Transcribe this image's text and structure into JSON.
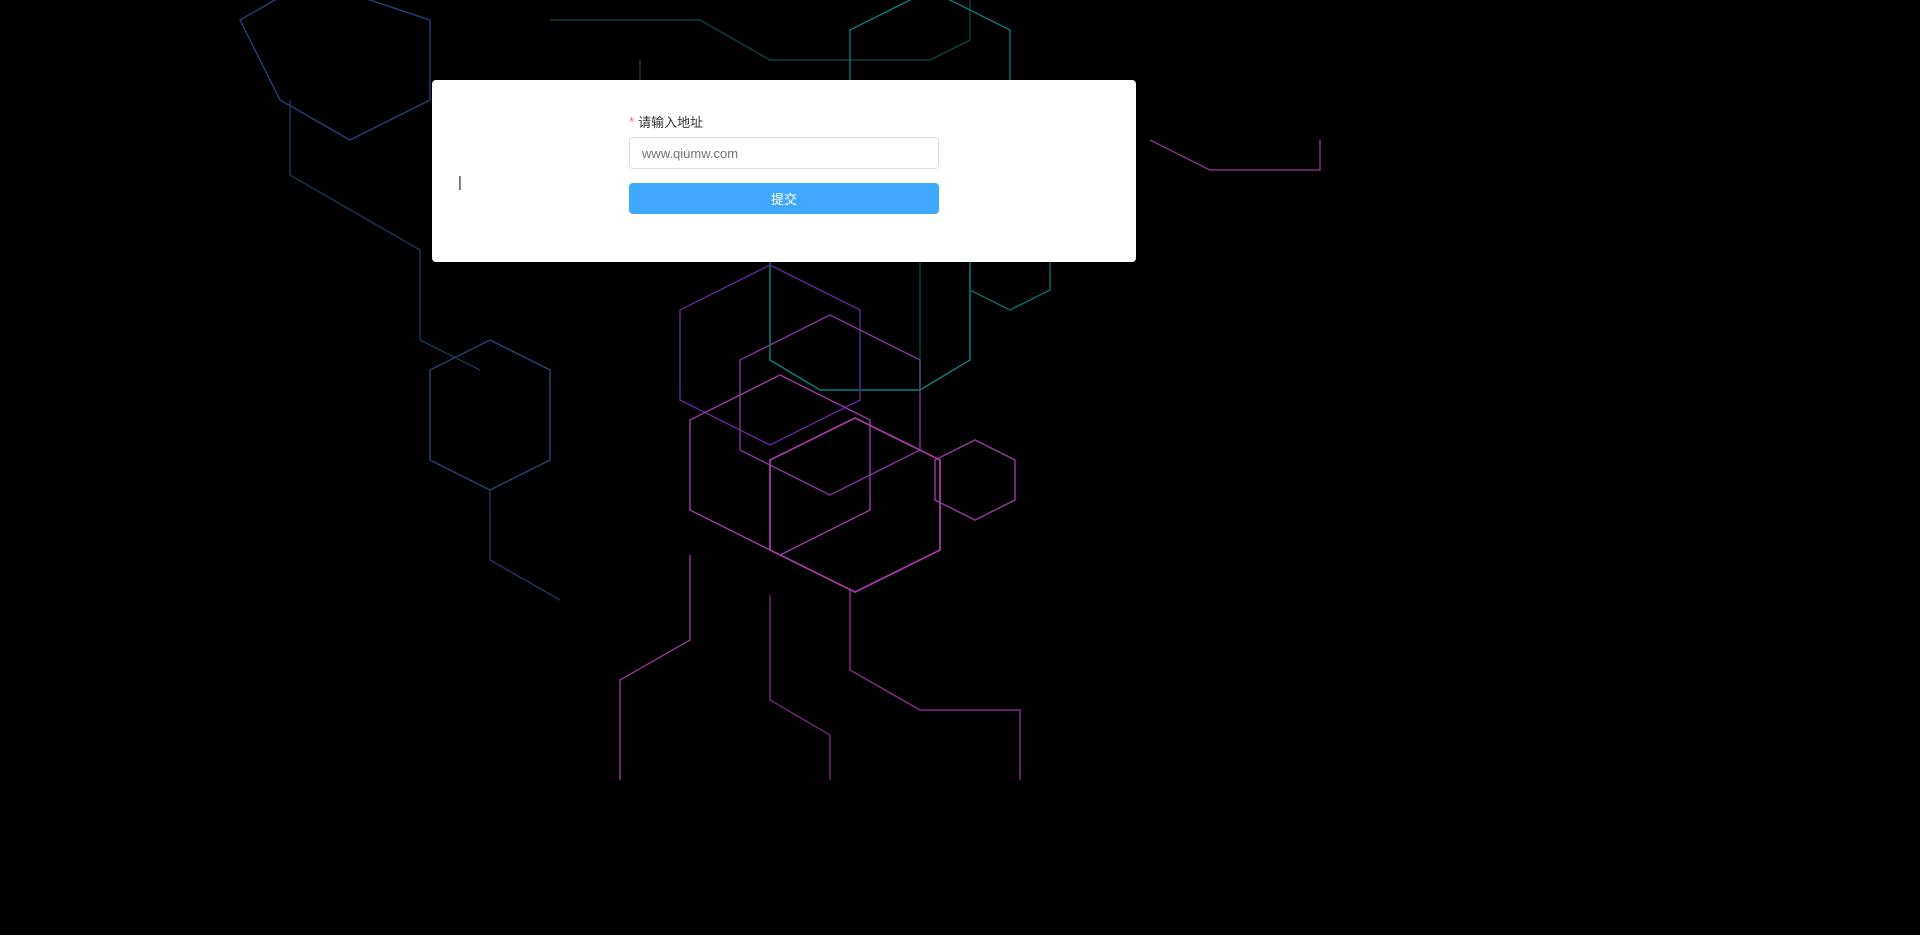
{
  "form": {
    "address_label": "请输入地址",
    "address_placeholder": "www.qiumw.com",
    "address_value": "",
    "submit_label": "提交"
  },
  "cursor": "|",
  "colors": {
    "accent": "#40a9ff",
    "required": "#f56c6c",
    "border": "#dcdfe6"
  }
}
